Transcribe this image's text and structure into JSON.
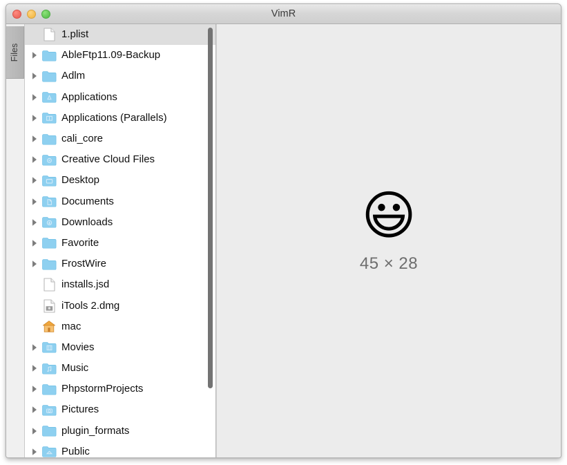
{
  "window": {
    "title": "VimR",
    "traffic_lights": [
      {
        "name": "close",
        "color": "#ec6a5f"
      },
      {
        "name": "minimize",
        "color": "#f4bd4f"
      },
      {
        "name": "zoom",
        "color": "#61c454"
      }
    ]
  },
  "sidebar": {
    "tab_label": "Files"
  },
  "filelist": {
    "items": [
      {
        "label": "1.plist",
        "icon": "file-icon",
        "expandable": false,
        "selected": true
      },
      {
        "label": "AbleFtp11.09-Backup",
        "icon": "folder-icon",
        "expandable": true,
        "selected": false
      },
      {
        "label": "Adlm",
        "icon": "folder-icon",
        "expandable": true,
        "selected": false
      },
      {
        "label": "Applications",
        "icon": "folder-applications-icon",
        "expandable": true,
        "selected": false
      },
      {
        "label": "Applications (Parallels)",
        "icon": "folder-parallels-icon",
        "expandable": true,
        "selected": false
      },
      {
        "label": "cali_core",
        "icon": "folder-icon",
        "expandable": true,
        "selected": false
      },
      {
        "label": "Creative Cloud Files",
        "icon": "folder-cloud-icon",
        "expandable": true,
        "selected": false
      },
      {
        "label": "Desktop",
        "icon": "folder-desktop-icon",
        "expandable": true,
        "selected": false
      },
      {
        "label": "Documents",
        "icon": "folder-documents-icon",
        "expandable": true,
        "selected": false
      },
      {
        "label": "Downloads",
        "icon": "folder-downloads-icon",
        "expandable": true,
        "selected": false
      },
      {
        "label": "Favorite",
        "icon": "folder-icon",
        "expandable": true,
        "selected": false
      },
      {
        "label": "FrostWire",
        "icon": "folder-icon",
        "expandable": true,
        "selected": false
      },
      {
        "label": "installs.jsd",
        "icon": "file-icon",
        "expandable": false,
        "selected": false
      },
      {
        "label": "iTools 2.dmg",
        "icon": "file-disk-image-icon",
        "expandable": false,
        "selected": false
      },
      {
        "label": "mac",
        "icon": "home-folder-icon",
        "expandable": false,
        "selected": false
      },
      {
        "label": "Movies",
        "icon": "folder-movies-icon",
        "expandable": true,
        "selected": false
      },
      {
        "label": "Music",
        "icon": "folder-music-icon",
        "expandable": true,
        "selected": false
      },
      {
        "label": "PhpstormProjects",
        "icon": "folder-icon",
        "expandable": true,
        "selected": false
      },
      {
        "label": "Pictures",
        "icon": "folder-pictures-icon",
        "expandable": true,
        "selected": false
      },
      {
        "label": "plugin_formats",
        "icon": "folder-icon",
        "expandable": true,
        "selected": false
      },
      {
        "label": "Public",
        "icon": "folder-public-icon",
        "expandable": true,
        "selected": false
      }
    ]
  },
  "content": {
    "emoji": "😃",
    "emoji_name": "grinning-face-icon",
    "dimensions": "45 × 28"
  },
  "colors": {
    "folder_blue": "#89cff0",
    "selection_gray": "#dedede",
    "content_bg": "#ececec",
    "dims_text": "#6e6e6e"
  }
}
